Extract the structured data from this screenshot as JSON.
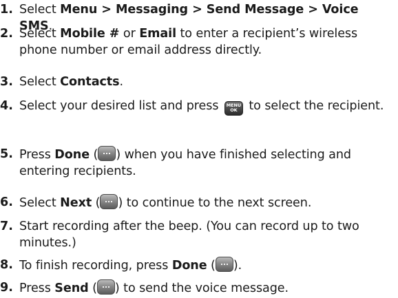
{
  "steps": [
    {
      "num": "1.",
      "parts": [
        {
          "t": "text",
          "v": "Select "
        },
        {
          "t": "bold",
          "v": "Menu > Messaging > Send Message > Voice SMS"
        },
        {
          "t": "text",
          "v": "."
        }
      ]
    },
    {
      "num": "2.",
      "parts": [
        {
          "t": "text",
          "v": "Select "
        },
        {
          "t": "bold",
          "v": "Mobile #"
        },
        {
          "t": "text",
          "v": " or "
        },
        {
          "t": "bold",
          "v": "Email"
        },
        {
          "t": "text",
          "v": " to enter a recipient’s wireless phone number or email address directly."
        }
      ]
    },
    {
      "num": "3.",
      "parts": [
        {
          "t": "text",
          "v": "Select "
        },
        {
          "t": "bold",
          "v": "Contacts"
        },
        {
          "t": "text",
          "v": "."
        }
      ]
    },
    {
      "num": "4.",
      "parts": [
        {
          "t": "text",
          "v": "Select your desired list and press "
        },
        {
          "t": "key",
          "v": "menu-ok-key-icon",
          "top": "MENU",
          "bottom": "OK"
        },
        {
          "t": "text",
          "v": " to select the recipient."
        }
      ]
    },
    {
      "num": "5.",
      "parts": [
        {
          "t": "text",
          "v": "Press "
        },
        {
          "t": "bold",
          "v": "Done"
        },
        {
          "t": "text",
          "v": " ("
        },
        {
          "t": "softkey",
          "v": "soft-key-icon"
        },
        {
          "t": "text",
          "v": ") when you have finished selecting and entering recipients."
        }
      ]
    },
    {
      "num": "6.",
      "parts": [
        {
          "t": "text",
          "v": "Select "
        },
        {
          "t": "bold",
          "v": "Next"
        },
        {
          "t": "text",
          "v": " ("
        },
        {
          "t": "softkey",
          "v": "soft-key-icon"
        },
        {
          "t": "text",
          "v": ") to continue to the next screen."
        }
      ]
    },
    {
      "num": "7.",
      "parts": [
        {
          "t": "text",
          "v": "Start recording after the beep. (You can record up to two minutes.)"
        }
      ]
    },
    {
      "num": "8.",
      "parts": [
        {
          "t": "text",
          "v": "To finish recording, press "
        },
        {
          "t": "bold",
          "v": "Done"
        },
        {
          "t": "text",
          "v": " ("
        },
        {
          "t": "softkey",
          "v": "soft-key-icon"
        },
        {
          "t": "text",
          "v": ")."
        }
      ]
    },
    {
      "num": "9.",
      "parts": [
        {
          "t": "text",
          "v": "Press "
        },
        {
          "t": "bold",
          "v": "Send"
        },
        {
          "t": "text",
          "v": " ("
        },
        {
          "t": "softkey",
          "v": "soft-key-icon"
        },
        {
          "t": "text",
          "v": ") to send the voice message."
        }
      ]
    }
  ]
}
